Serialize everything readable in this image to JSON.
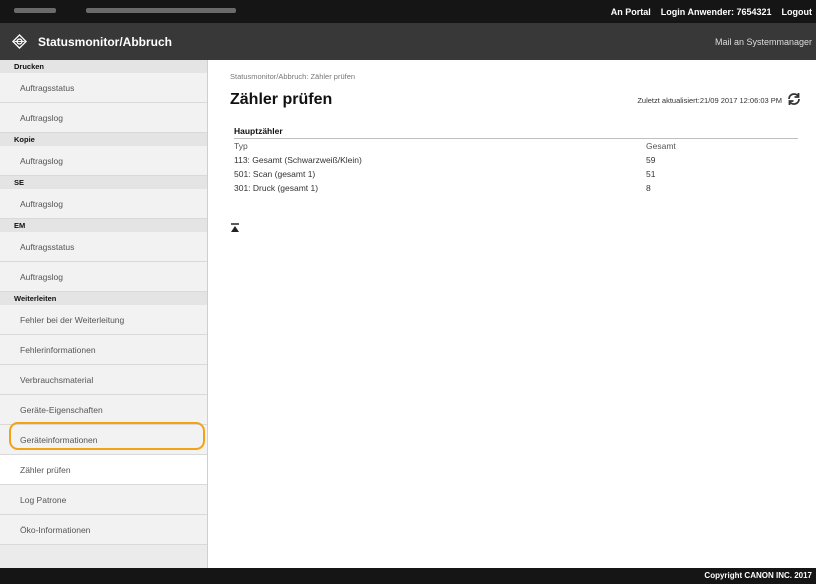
{
  "topbar": {
    "portal_link": "An Portal",
    "login_label": "Login Anwender: 7654321",
    "logout_link": "Logout"
  },
  "header": {
    "app_title": "Statusmonitor/Abbruch",
    "mail_link": "Mail an Systemmanager"
  },
  "sidebar": {
    "sections": [
      {
        "title": "Drucken",
        "items": [
          "Auftragsstatus",
          "Auftragslog"
        ]
      },
      {
        "title": "Kopie",
        "items": [
          "Auftragslog"
        ]
      },
      {
        "title": "SE",
        "items": [
          "Auftragslog"
        ]
      },
      {
        "title": "EM",
        "items": [
          "Auftragsstatus",
          "Auftragslog"
        ]
      },
      {
        "title": "Weiterleiten",
        "items": [
          "Fehler bei der Weiterleitung"
        ]
      }
    ],
    "items": [
      "Fehlerinformationen",
      "Verbrauchsmaterial",
      "Geräte-Eigenschaften",
      "Geräteinformationen",
      "Zähler prüfen",
      "Log Patrone",
      "Öko-Informationen"
    ],
    "active_item": "Zähler prüfen"
  },
  "main": {
    "breadcrumb": "Statusmonitor/Abbruch: Zähler prüfen",
    "title": "Zähler prüfen",
    "last_updated": "Zuletzt aktualisiert:21/09 2017 12:06:03 PM",
    "refresh_icon": "refresh-icon",
    "section_title": "Hauptzähler",
    "columns": [
      "Typ",
      "Gesamt"
    ],
    "rows": [
      [
        "113: Gesamt (Schwarzweiß/Klein)",
        "59"
      ],
      [
        "501: Scan (gesamt 1)",
        "51"
      ],
      [
        "301: Druck (gesamt 1)",
        "8"
      ]
    ],
    "to_top_icon": "to-top-icon"
  },
  "footer": {
    "copyright": "Copyright CANON INC. 2017"
  },
  "colors": {
    "highlight": "#f3a218",
    "topbar": "#151515",
    "header": "#383838",
    "sidebar": "#ebebeb"
  }
}
